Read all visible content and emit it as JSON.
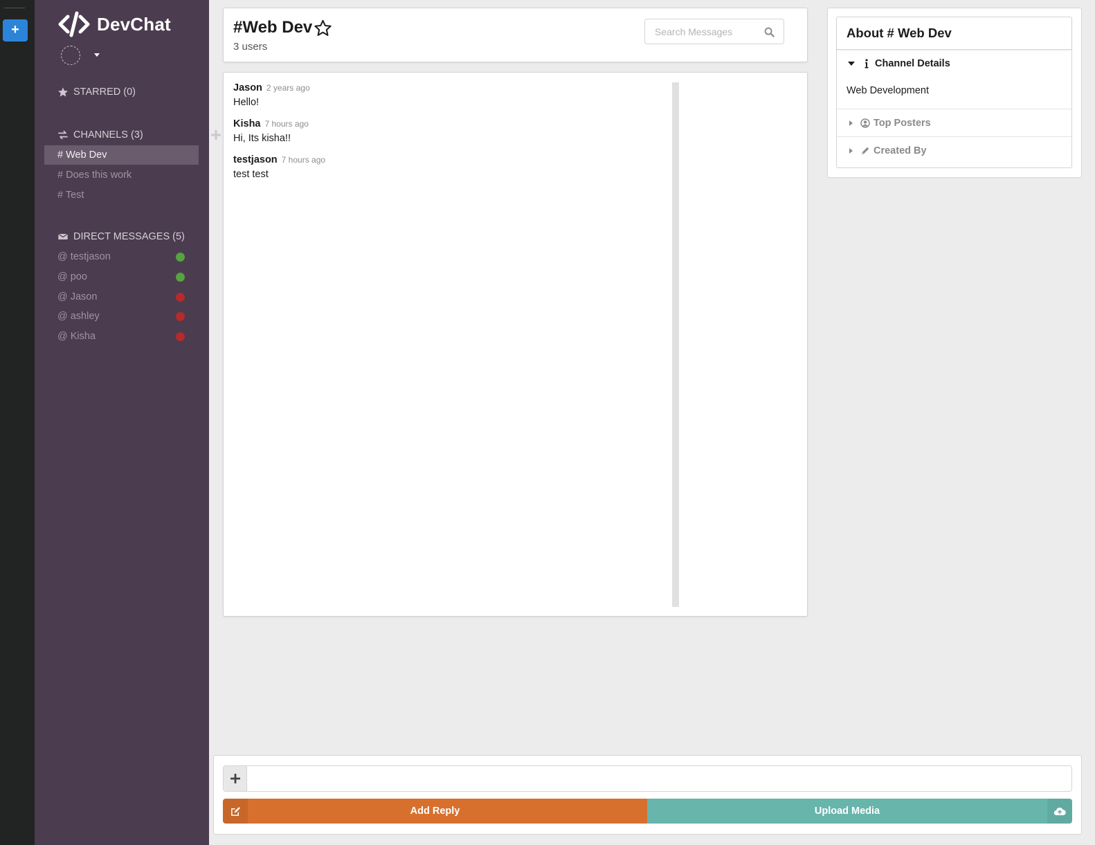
{
  "app": {
    "name": "DevChat"
  },
  "sidebar": {
    "starred": {
      "label": "STARRED (0)"
    },
    "channels": {
      "label": "CHANNELS (3)",
      "items": [
        {
          "label": "# Web Dev",
          "active": true
        },
        {
          "label": "# Does this work",
          "active": false
        },
        {
          "label": "# Test",
          "active": false
        }
      ]
    },
    "direct_messages": {
      "label": "DIRECT MESSAGES (5)",
      "items": [
        {
          "label": "@ testjason",
          "status": "online"
        },
        {
          "label": "@ poo",
          "status": "online"
        },
        {
          "label": "@ Jason",
          "status": "offline"
        },
        {
          "label": "@ ashley",
          "status": "offline"
        },
        {
          "label": "@ Kisha",
          "status": "offline"
        }
      ]
    }
  },
  "header": {
    "channel_title": "#Web Dev",
    "user_count": "3 users",
    "search_placeholder": "Search Messages"
  },
  "messages": [
    {
      "author": "Jason",
      "time": "2 years ago",
      "text": "Hello!"
    },
    {
      "author": "Kisha",
      "time": "7 hours ago",
      "text": "Hi, Its kisha!!"
    },
    {
      "author": "testjason",
      "time": "7 hours ago",
      "text": "test test"
    }
  ],
  "about": {
    "title": "About # Web Dev",
    "sections": [
      {
        "label": "Channel Details",
        "content": "Web Development"
      },
      {
        "label": "Top Posters"
      },
      {
        "label": "Created By"
      }
    ]
  },
  "form": {
    "reply_label": "Add Reply",
    "upload_label": "Upload Media",
    "message_value": ""
  },
  "colors": {
    "sidebar_bg": "#4b3c4f",
    "strip_bg": "#222323",
    "accent_blue": "#2c84d9",
    "reply_orange": "#d8702d",
    "upload_teal": "#68b5ac",
    "online": "#58a33f",
    "offline": "#b52b2b"
  }
}
